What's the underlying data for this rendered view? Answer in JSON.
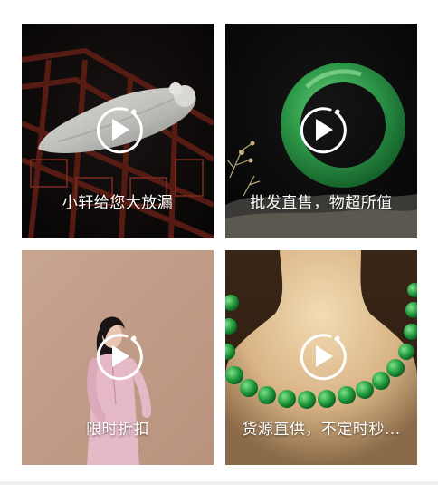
{
  "videos": [
    {
      "caption": "小轩给您大放漏",
      "icon": "play-icon"
    },
    {
      "caption": "批发直售，物超所值",
      "icon": "play-icon"
    },
    {
      "caption": "限时折扣",
      "icon": "play-icon"
    },
    {
      "caption": "货源直供，不定时秒...",
      "icon": "play-icon"
    }
  ],
  "colors": {
    "overlay_text": "#ffffff",
    "jade_green": "#2f9a4a",
    "card3_bg": "#c8a591"
  }
}
